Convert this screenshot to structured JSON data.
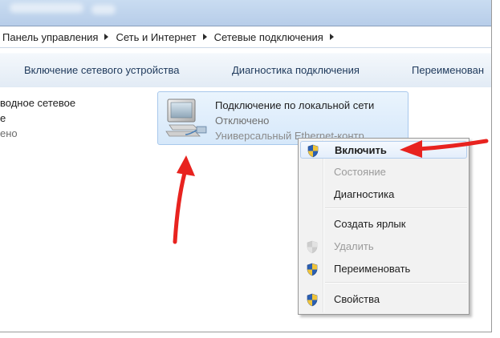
{
  "address": {
    "breadcrumbs": [
      {
        "label": "Панель управления"
      },
      {
        "label": "Сеть и Интернет"
      },
      {
        "label": "Сетевые подключения"
      }
    ]
  },
  "toolbar": {
    "items": [
      {
        "label": "Включение сетевого устройства"
      },
      {
        "label": "Диагностика подключения"
      },
      {
        "label": "Переименован"
      }
    ]
  },
  "left_connection": {
    "line1": "водное сетевое",
    "line2": "е",
    "line3": "ено"
  },
  "connection": {
    "name": "Подключение по локальной сети",
    "status": "Отключено",
    "adapter": "Универсальный Ethernet-контр"
  },
  "context_menu": {
    "items": [
      {
        "label": "Включить",
        "icon": "uac-shield-icon"
      },
      {
        "label": "Состояние"
      },
      {
        "label": "Диагностика"
      },
      {
        "label": "Создать ярлык"
      },
      {
        "label": "Удалить",
        "icon": "uac-shield-icon"
      },
      {
        "label": "Переименовать",
        "icon": "uac-shield-icon"
      },
      {
        "label": "Свойства",
        "icon": "uac-shield-icon"
      }
    ]
  },
  "colors": {
    "annotation_arrow": "#e8231f",
    "highlight_border": "#b4cdec",
    "tile_border": "#a8c8ec"
  }
}
